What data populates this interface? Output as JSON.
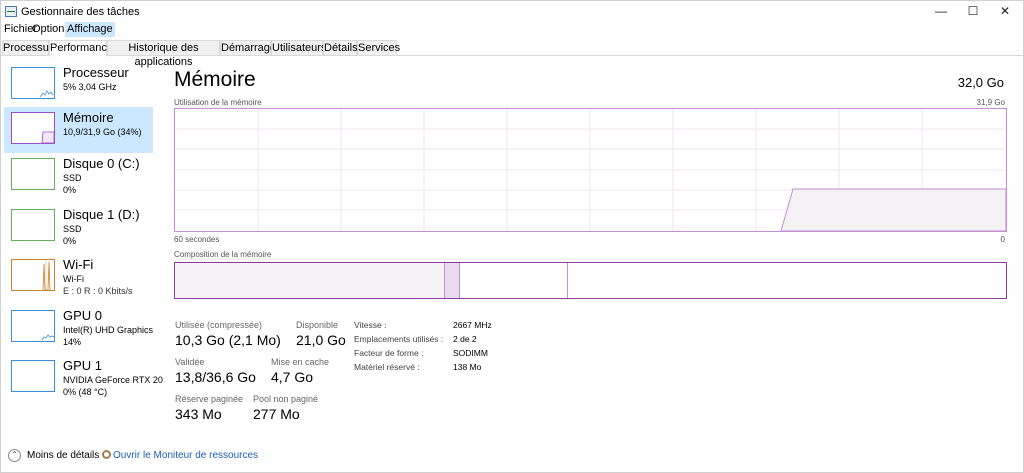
{
  "window": {
    "title": "Gestionnaire des tâches",
    "controls": {
      "minimize": "—",
      "maximize": "☐",
      "close": "✕"
    }
  },
  "menu": [
    "Fichier",
    "Options",
    "Affichage"
  ],
  "tabs": [
    "Processus",
    "Performance",
    "Historique des applications",
    "Démarrage",
    "Utilisateurs",
    "Détails",
    "Services"
  ],
  "active_tab": "Performance",
  "sidebar": {
    "items": [
      {
        "title": "Processeur",
        "line1": "5%  3,04 GHz",
        "line2": "",
        "color": "#3c8fd6",
        "icon": "cpu-graph"
      },
      {
        "title": "Mémoire",
        "line1": "10,9/31,9 Go (34%)",
        "line2": "",
        "color": "#9b4dca",
        "icon": "memory-graph",
        "selected": true
      },
      {
        "title": "Disque 0 (C:)",
        "line1": "SSD",
        "line2": "0%",
        "color": "#61b15a",
        "icon": "disk-graph"
      },
      {
        "title": "Disque 1 (D:)",
        "line1": "SSD",
        "line2": "0%",
        "color": "#61b15a",
        "icon": "disk-graph"
      },
      {
        "title": "Wi-Fi",
        "line1": "Wi-Fi",
        "line2": "E : 0 R : 0 Kbits/s",
        "color": "#c9822f",
        "icon": "wifi-graph"
      },
      {
        "title": "GPU 0",
        "line1": "Intel(R) UHD Graphics",
        "line2": "14%",
        "color": "#3c8fd6",
        "icon": "gpu-graph"
      },
      {
        "title": "GPU 1",
        "line1": "NVIDIA GeForce RTX 20",
        "line2": "0%  (48 °C)",
        "color": "#3c8fd6",
        "icon": "gpu-graph"
      }
    ]
  },
  "main": {
    "title": "Mémoire",
    "total": "32,0 Go",
    "usage_label": "Utilisation de la mémoire",
    "usage_max": "31,9 Go",
    "time_left": "60 secondes",
    "time_right": "0",
    "composition_label": "Composition de la mémoire",
    "composition": {
      "in_use_fraction": 0.325,
      "modified_fraction": 0.018,
      "standby_fraction": 0.13
    },
    "stats": {
      "used_label": "Utilisée (compressée)",
      "used_value": "10,3 Go (2,1 Mo)",
      "available_label": "Disponible",
      "available_value": "21,0 Go",
      "committed_label": "Validée",
      "committed_value": "13,8/36,6 Go",
      "cached_label": "Mise en cache",
      "cached_value": "4,7 Go",
      "paged_label": "Réserve paginée",
      "paged_value": "343 Mo",
      "nonpaged_label": "Pool non paginé",
      "nonpaged_value": "277 Mo"
    },
    "details": [
      {
        "key": "Vitesse :",
        "value": "2667 MHz"
      },
      {
        "key": "Emplacements utilisés :",
        "value": "2 de 2"
      },
      {
        "key": "Facteur de forme :",
        "value": "SODIMM"
      },
      {
        "key": "Matériel réservé :",
        "value": "138 Mo"
      }
    ]
  },
  "footer": {
    "less_details": "Moins de détails",
    "resource_monitor": "Ouvrir le Moniteur de ressources"
  },
  "colors": {
    "memory_border": "#c48ed2",
    "memory_fill": "#f4f2f4",
    "memory_line": "#9b4dca",
    "selected_bg": "#cce8ff",
    "link": "#1a5fb4"
  }
}
